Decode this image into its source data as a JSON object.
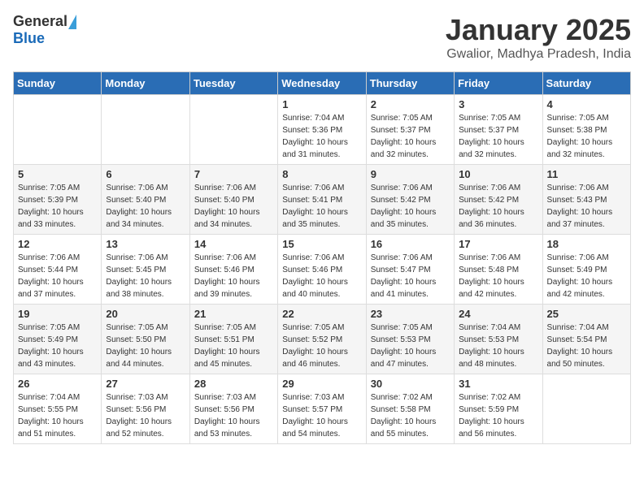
{
  "header": {
    "logo_general": "General",
    "logo_blue": "Blue",
    "title": "January 2025",
    "subtitle": "Gwalior, Madhya Pradesh, India"
  },
  "weekdays": [
    "Sunday",
    "Monday",
    "Tuesday",
    "Wednesday",
    "Thursday",
    "Friday",
    "Saturday"
  ],
  "weeks": [
    [
      {
        "day": "",
        "sunrise": "",
        "sunset": "",
        "daylight": ""
      },
      {
        "day": "",
        "sunrise": "",
        "sunset": "",
        "daylight": ""
      },
      {
        "day": "",
        "sunrise": "",
        "sunset": "",
        "daylight": ""
      },
      {
        "day": "1",
        "sunrise": "Sunrise: 7:04 AM",
        "sunset": "Sunset: 5:36 PM",
        "daylight": "Daylight: 10 hours and 31 minutes."
      },
      {
        "day": "2",
        "sunrise": "Sunrise: 7:05 AM",
        "sunset": "Sunset: 5:37 PM",
        "daylight": "Daylight: 10 hours and 32 minutes."
      },
      {
        "day": "3",
        "sunrise": "Sunrise: 7:05 AM",
        "sunset": "Sunset: 5:37 PM",
        "daylight": "Daylight: 10 hours and 32 minutes."
      },
      {
        "day": "4",
        "sunrise": "Sunrise: 7:05 AM",
        "sunset": "Sunset: 5:38 PM",
        "daylight": "Daylight: 10 hours and 32 minutes."
      }
    ],
    [
      {
        "day": "5",
        "sunrise": "Sunrise: 7:05 AM",
        "sunset": "Sunset: 5:39 PM",
        "daylight": "Daylight: 10 hours and 33 minutes."
      },
      {
        "day": "6",
        "sunrise": "Sunrise: 7:06 AM",
        "sunset": "Sunset: 5:40 PM",
        "daylight": "Daylight: 10 hours and 34 minutes."
      },
      {
        "day": "7",
        "sunrise": "Sunrise: 7:06 AM",
        "sunset": "Sunset: 5:40 PM",
        "daylight": "Daylight: 10 hours and 34 minutes."
      },
      {
        "day": "8",
        "sunrise": "Sunrise: 7:06 AM",
        "sunset": "Sunset: 5:41 PM",
        "daylight": "Daylight: 10 hours and 35 minutes."
      },
      {
        "day": "9",
        "sunrise": "Sunrise: 7:06 AM",
        "sunset": "Sunset: 5:42 PM",
        "daylight": "Daylight: 10 hours and 35 minutes."
      },
      {
        "day": "10",
        "sunrise": "Sunrise: 7:06 AM",
        "sunset": "Sunset: 5:42 PM",
        "daylight": "Daylight: 10 hours and 36 minutes."
      },
      {
        "day": "11",
        "sunrise": "Sunrise: 7:06 AM",
        "sunset": "Sunset: 5:43 PM",
        "daylight": "Daylight: 10 hours and 37 minutes."
      }
    ],
    [
      {
        "day": "12",
        "sunrise": "Sunrise: 7:06 AM",
        "sunset": "Sunset: 5:44 PM",
        "daylight": "Daylight: 10 hours and 37 minutes."
      },
      {
        "day": "13",
        "sunrise": "Sunrise: 7:06 AM",
        "sunset": "Sunset: 5:45 PM",
        "daylight": "Daylight: 10 hours and 38 minutes."
      },
      {
        "day": "14",
        "sunrise": "Sunrise: 7:06 AM",
        "sunset": "Sunset: 5:46 PM",
        "daylight": "Daylight: 10 hours and 39 minutes."
      },
      {
        "day": "15",
        "sunrise": "Sunrise: 7:06 AM",
        "sunset": "Sunset: 5:46 PM",
        "daylight": "Daylight: 10 hours and 40 minutes."
      },
      {
        "day": "16",
        "sunrise": "Sunrise: 7:06 AM",
        "sunset": "Sunset: 5:47 PM",
        "daylight": "Daylight: 10 hours and 41 minutes."
      },
      {
        "day": "17",
        "sunrise": "Sunrise: 7:06 AM",
        "sunset": "Sunset: 5:48 PM",
        "daylight": "Daylight: 10 hours and 42 minutes."
      },
      {
        "day": "18",
        "sunrise": "Sunrise: 7:06 AM",
        "sunset": "Sunset: 5:49 PM",
        "daylight": "Daylight: 10 hours and 42 minutes."
      }
    ],
    [
      {
        "day": "19",
        "sunrise": "Sunrise: 7:05 AM",
        "sunset": "Sunset: 5:49 PM",
        "daylight": "Daylight: 10 hours and 43 minutes."
      },
      {
        "day": "20",
        "sunrise": "Sunrise: 7:05 AM",
        "sunset": "Sunset: 5:50 PM",
        "daylight": "Daylight: 10 hours and 44 minutes."
      },
      {
        "day": "21",
        "sunrise": "Sunrise: 7:05 AM",
        "sunset": "Sunset: 5:51 PM",
        "daylight": "Daylight: 10 hours and 45 minutes."
      },
      {
        "day": "22",
        "sunrise": "Sunrise: 7:05 AM",
        "sunset": "Sunset: 5:52 PM",
        "daylight": "Daylight: 10 hours and 46 minutes."
      },
      {
        "day": "23",
        "sunrise": "Sunrise: 7:05 AM",
        "sunset": "Sunset: 5:53 PM",
        "daylight": "Daylight: 10 hours and 47 minutes."
      },
      {
        "day": "24",
        "sunrise": "Sunrise: 7:04 AM",
        "sunset": "Sunset: 5:53 PM",
        "daylight": "Daylight: 10 hours and 48 minutes."
      },
      {
        "day": "25",
        "sunrise": "Sunrise: 7:04 AM",
        "sunset": "Sunset: 5:54 PM",
        "daylight": "Daylight: 10 hours and 50 minutes."
      }
    ],
    [
      {
        "day": "26",
        "sunrise": "Sunrise: 7:04 AM",
        "sunset": "Sunset: 5:55 PM",
        "daylight": "Daylight: 10 hours and 51 minutes."
      },
      {
        "day": "27",
        "sunrise": "Sunrise: 7:03 AM",
        "sunset": "Sunset: 5:56 PM",
        "daylight": "Daylight: 10 hours and 52 minutes."
      },
      {
        "day": "28",
        "sunrise": "Sunrise: 7:03 AM",
        "sunset": "Sunset: 5:56 PM",
        "daylight": "Daylight: 10 hours and 53 minutes."
      },
      {
        "day": "29",
        "sunrise": "Sunrise: 7:03 AM",
        "sunset": "Sunset: 5:57 PM",
        "daylight": "Daylight: 10 hours and 54 minutes."
      },
      {
        "day": "30",
        "sunrise": "Sunrise: 7:02 AM",
        "sunset": "Sunset: 5:58 PM",
        "daylight": "Daylight: 10 hours and 55 minutes."
      },
      {
        "day": "31",
        "sunrise": "Sunrise: 7:02 AM",
        "sunset": "Sunset: 5:59 PM",
        "daylight": "Daylight: 10 hours and 56 minutes."
      },
      {
        "day": "",
        "sunrise": "",
        "sunset": "",
        "daylight": ""
      }
    ]
  ]
}
